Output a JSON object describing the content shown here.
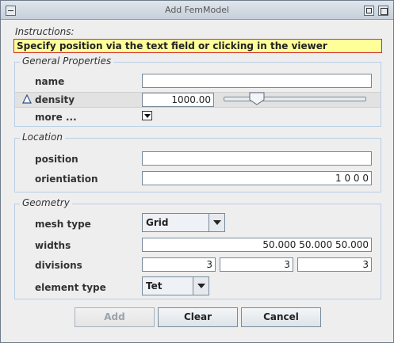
{
  "window": {
    "title": "Add FemModel"
  },
  "instructions": {
    "label": "Instructions:",
    "text": "Specify position via the text field or clicking in the viewer"
  },
  "general": {
    "title": "General Properties",
    "name_label": "name",
    "name_value": "",
    "density_label": "density",
    "density_value": "1000.00",
    "density_slider_fraction": 0.2,
    "more_label": "more ..."
  },
  "location": {
    "title": "Location",
    "position_label": "position",
    "position_value": "",
    "orientation_label": "orientiation",
    "orientation_value": "1 0 0 0"
  },
  "geometry": {
    "title": "Geometry",
    "mesh_type_label": "mesh type",
    "mesh_type_value": "Grid",
    "widths_label": "widths",
    "widths_value": "50.000  50.000  50.000",
    "divisions_label": "divisions",
    "divisions_values": [
      "3",
      "3",
      "3"
    ],
    "element_type_label": "element type",
    "element_type_value": "Tet"
  },
  "buttons": {
    "add": "Add",
    "clear": "Clear",
    "cancel": "Cancel"
  },
  "colors": {
    "instructions_bg": "#ffff99",
    "instructions_border": "#d03030",
    "group_border": "#b8cfe5",
    "window_bg": "#eeeeee"
  }
}
